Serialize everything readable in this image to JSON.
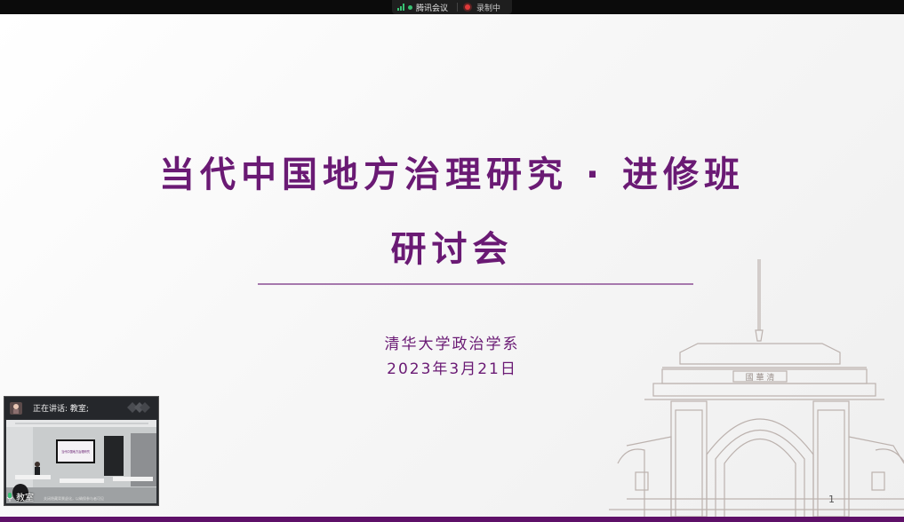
{
  "meeting": {
    "app_name": "腾讯会议",
    "recording_label": "录制中"
  },
  "slide": {
    "title_line1": "当代中国地方治理研究 · 进修班",
    "title_line2": "研讨会",
    "department": "清华大学政治学系",
    "date": "2023年3月21日",
    "page_number": "1",
    "colors": {
      "title": "#6a1a74",
      "bottom_bar": "#5e1068"
    }
  },
  "video": {
    "speaking_label": "正在讲话: 教室;",
    "participant_name": "教室",
    "screen_caption": "当代中国地方治理研究",
    "bottom_caption": "关闭隐藏背景虚化，以确保参与者可见"
  }
}
